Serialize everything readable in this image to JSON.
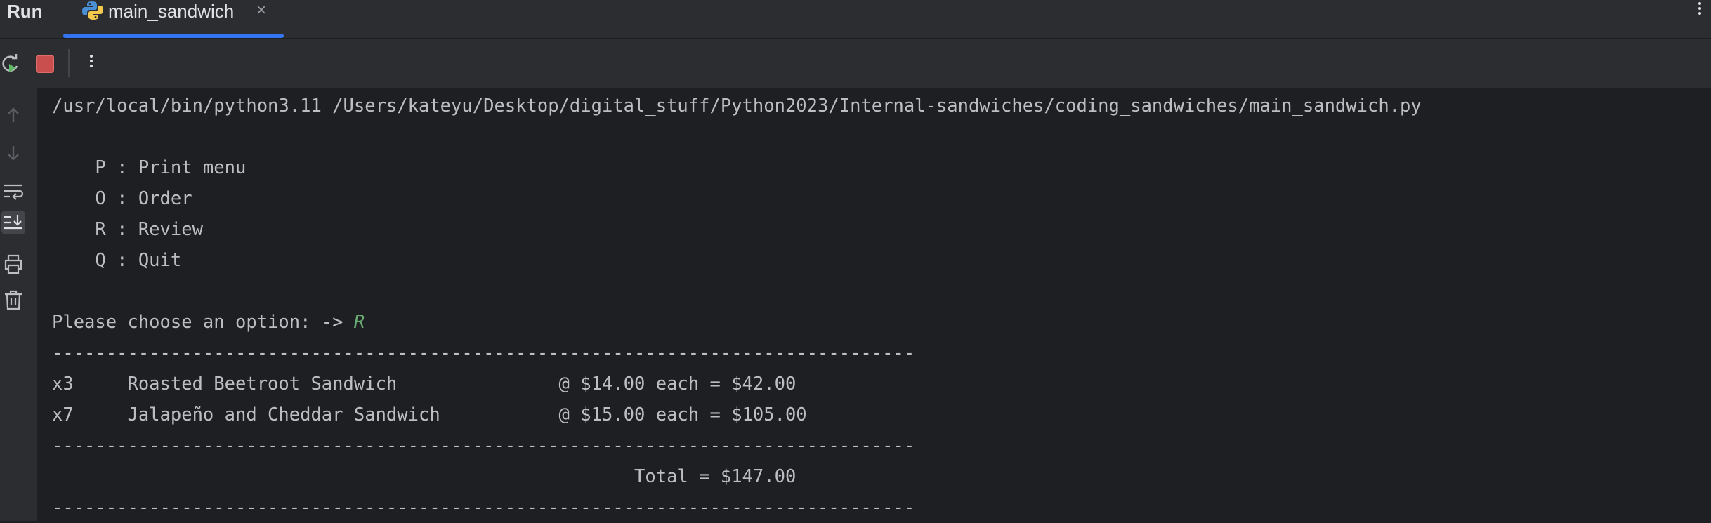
{
  "topbar": {
    "run_label": "Run",
    "tab_title": "main_sandwich",
    "tab_close": "×",
    "tab_icon": "python-icon",
    "accent": "#3574f0"
  },
  "toolbar": {
    "icons": [
      "rerun-icon",
      "stop-icon",
      "more-vertical-icon"
    ]
  },
  "gutter": {
    "icons": [
      "arrow-up-icon",
      "arrow-down-icon",
      "soft-wrap-icon",
      "scroll-to-end-icon",
      "print-icon",
      "trash-icon"
    ]
  },
  "console": {
    "command": "/usr/local/bin/python3.11 /Users/kateyu/Desktop/digital_stuff/Python2023/Internal-sandwiches/coding_sandwiches/main_sandwich.py",
    "menu": [
      "    P : Print menu",
      "    O : Order",
      "    R : Review",
      "    Q : Quit"
    ],
    "prompt": "Please choose an option: -> ",
    "user_input": "R",
    "separator": "--------------------------------------------------------------------------------",
    "order_lines": [
      "x3     Roasted Beetroot Sandwich               @ $14.00 each = $42.00",
      "x7     Jalapeño and Cheddar Sandwich           @ $15.00 each = $105.00"
    ],
    "total_line": "                                                      Total = $147.00",
    "input_color": "#6aab73"
  }
}
